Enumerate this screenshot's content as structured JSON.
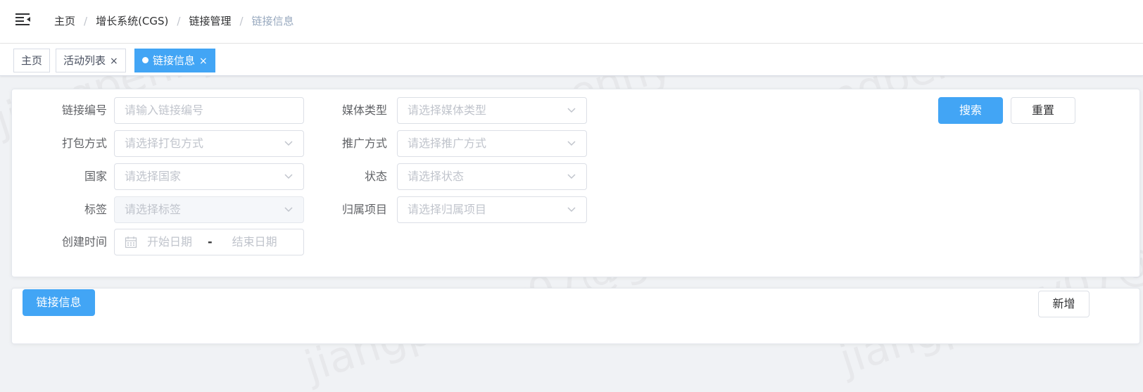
{
  "breadcrumb": [
    "主页",
    "增长系统(CGS)",
    "链接管理",
    "链接信息"
  ],
  "breadcrumb_separator": "/",
  "tags": [
    {
      "label": "主页",
      "closable": false,
      "active": false
    },
    {
      "label": "活动列表",
      "closable": true,
      "active": false
    },
    {
      "label": "链接信息",
      "closable": true,
      "active": true
    }
  ],
  "tag_close_glyph": "×",
  "filters": {
    "link_id": {
      "label": "链接编号",
      "placeholder": "请输入链接编号"
    },
    "media_type": {
      "label": "媒体类型",
      "placeholder": "请选择媒体类型"
    },
    "pack_method": {
      "label": "打包方式",
      "placeholder": "请选择打包方式"
    },
    "promo_method": {
      "label": "推广方式",
      "placeholder": "请选择推广方式"
    },
    "country": {
      "label": "国家",
      "placeholder": "请选择国家"
    },
    "status": {
      "label": "状态",
      "placeholder": "请选择状态"
    },
    "tag": {
      "label": "标签",
      "placeholder": "请选择标签",
      "disabled": true
    },
    "project": {
      "label": "归属项目",
      "placeholder": "请选择归属项目"
    },
    "created_time": {
      "label": "创建时间",
      "start_placeholder": "开始日期",
      "separator": "-",
      "end_placeholder": "结束日期"
    }
  },
  "buttons": {
    "search": "搜索",
    "reset": "重置",
    "link_info": "链接信息",
    "add": "新增"
  },
  "watermark": "jiangpenny07@gmail",
  "colors": {
    "primary": "#42a5f5",
    "breadcrumb_current": "#97a8be",
    "placeholder": "#c0c4cc"
  },
  "icons": {
    "menu": "hamburger-fold-icon",
    "select": "chevron-down-icon",
    "date": "calendar-icon",
    "collapse": "caret-down-icon"
  }
}
